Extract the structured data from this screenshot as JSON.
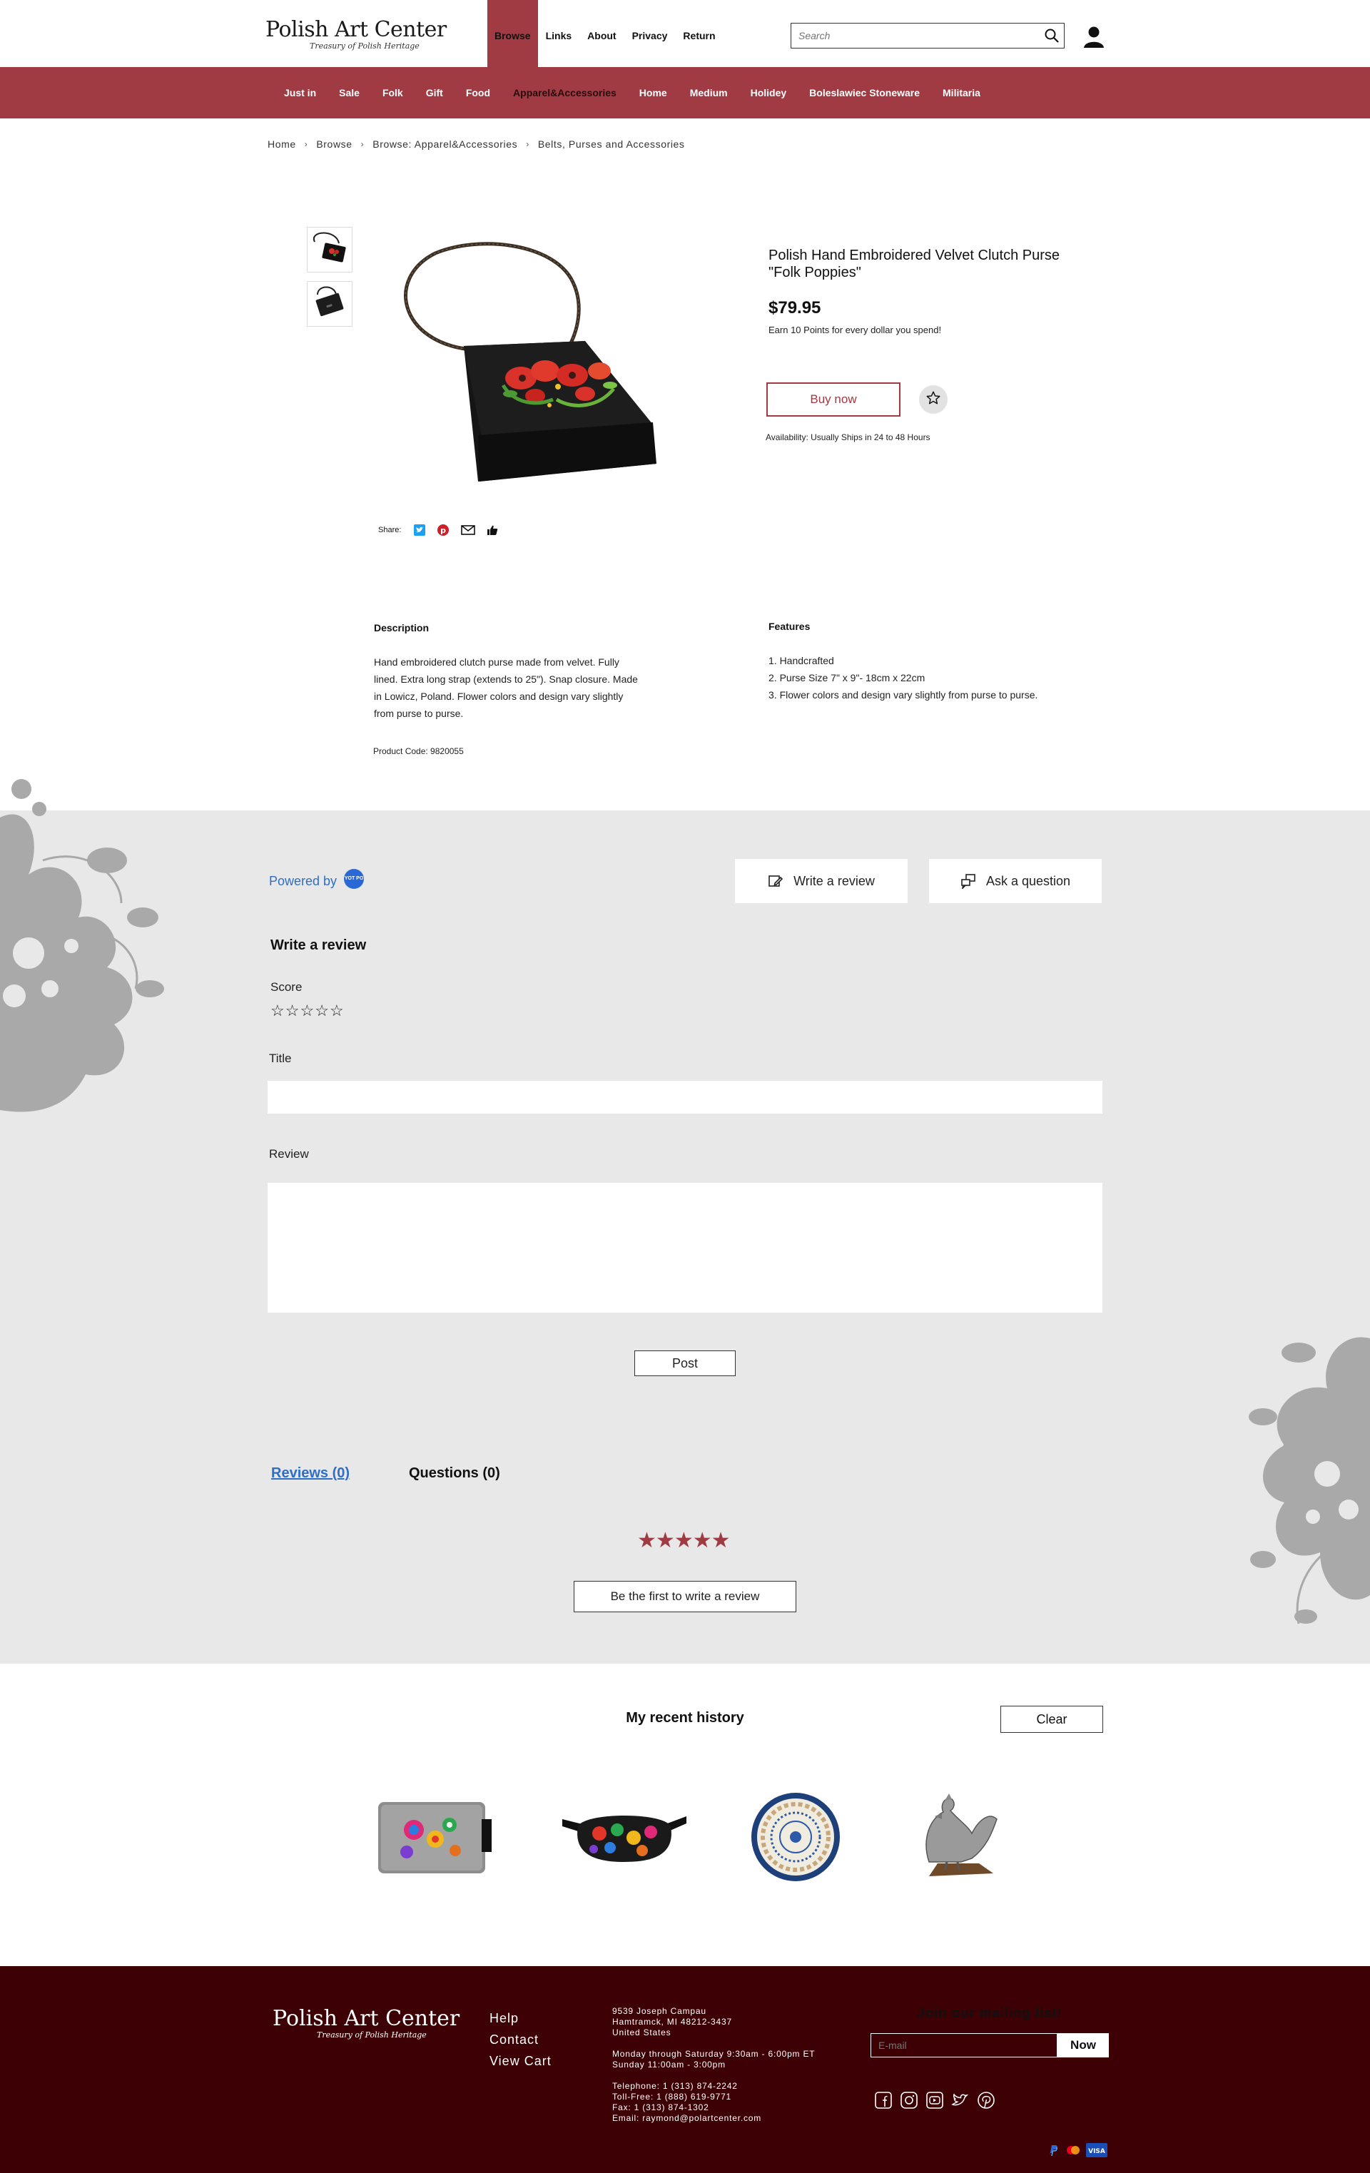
{
  "header": {
    "logo_title": "Polish Art Center",
    "logo_tagline": "Treasury of Polish Heritage",
    "nav": [
      "Browse",
      "Links",
      "About",
      "Privacy",
      "Return"
    ],
    "search_placeholder": "Search"
  },
  "categories": [
    "Just in",
    "Sale",
    "Folk",
    "Gift",
    "Food",
    "Apparel&Accessories",
    "Home",
    "Medium",
    "Holidey",
    "Boleslawiec Stoneware",
    "Militaria"
  ],
  "breadcrumb": [
    "Home",
    "Browse",
    "Browse: Apparel&Accessories",
    "Belts, Purses and Accessories"
  ],
  "product": {
    "title": "Polish Hand Embroidered Velvet Clutch Purse \"Folk Poppies\"",
    "price": "$79.95",
    "points": "Earn 10 Points for every dollar you spend!",
    "buy_label": "Buy now",
    "availability": "Availability: Usually Ships in 24 to 48 Hours",
    "share_label": "Share:",
    "description_heading": "Description",
    "description": "Hand embroidered clutch purse made from velvet.  Fully lined.  Extra long strap (extends to 25\"). Snap closure. Made in Lowicz, Poland.  Flower colors and design vary slightly from purse to purse.",
    "features_heading": "Features",
    "features": [
      "1. Handcrafted",
      "2. Purse Size 7\" x 9\"- 18cm x 22cm",
      "3. Flower colors and design vary slightly from purse to purse."
    ],
    "product_code": "Product Code: 9820055"
  },
  "reviews": {
    "powered_by": "Powered by",
    "yotpo_logo": "YOT PO",
    "write_review_btn": "Write a review",
    "ask_question_btn": "Ask a question",
    "form_title": "Write a review",
    "score_label": "Score",
    "title_label": "Title",
    "review_label": "Review",
    "post_label": "Post",
    "tab_reviews": "Reviews (0)",
    "tab_questions": "Questions (0)",
    "first_review_btn": "Be the first to write a review",
    "accent_color": "#a03a43"
  },
  "recent_history": {
    "title": "My recent history",
    "clear_label": "Clear"
  },
  "footer": {
    "logo_title": "Polish Art Center",
    "logo_tagline": "Treasury of Polish Heritage",
    "links": [
      "Help",
      "Contact",
      "View Cart"
    ],
    "address": [
      "9539 Joseph Campau",
      "Hamtramck, MI 48212-3437",
      "United States"
    ],
    "hours": [
      "Monday through Saturday 9:30am - 6:00pm ET",
      "Sunday 11:00am - 3:00pm"
    ],
    "contact": [
      "Telephone: 1 (313) 874-2242",
      "Toll-Free: 1 (888) 619-9771",
      "Fax: 1 (313) 874-1302",
      "Email: raymond@polartcenter.com"
    ],
    "mailing_title": "Join our mailing list!",
    "email_placeholder": "E-mail",
    "now_label": "Now",
    "background": "#3d0005"
  }
}
